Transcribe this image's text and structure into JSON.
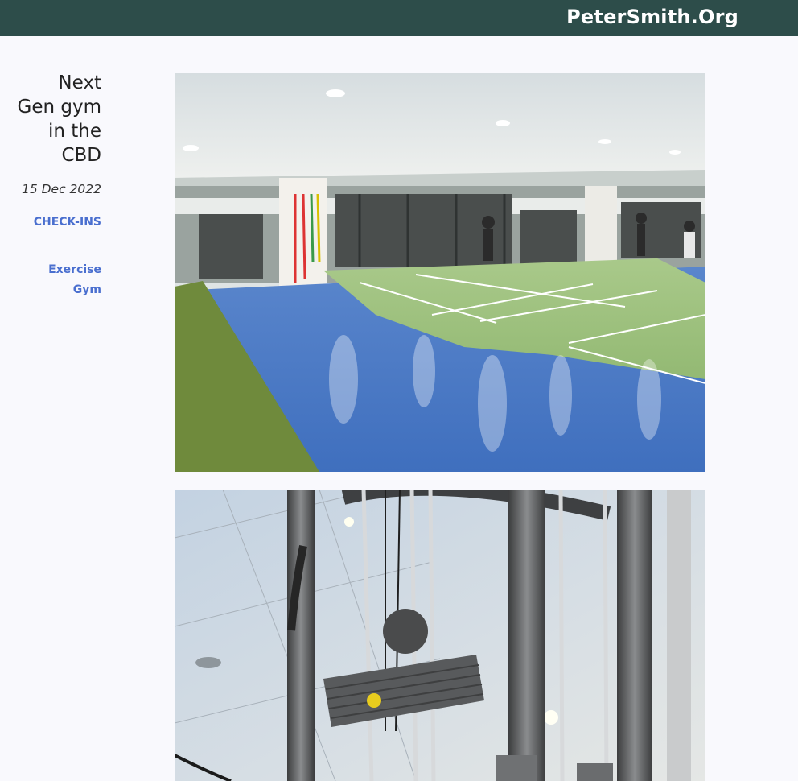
{
  "header": {
    "site_title": "PeterSmith.Org"
  },
  "post": {
    "title": "Next Gen gym in the CBD",
    "date": "15 Dec 2022",
    "category": "CHECK-INS",
    "tags": [
      "Exercise",
      "Gym"
    ]
  },
  "images": [
    {
      "subject": "gym-floor-photo"
    },
    {
      "subject": "cable-machine-photo"
    }
  ]
}
